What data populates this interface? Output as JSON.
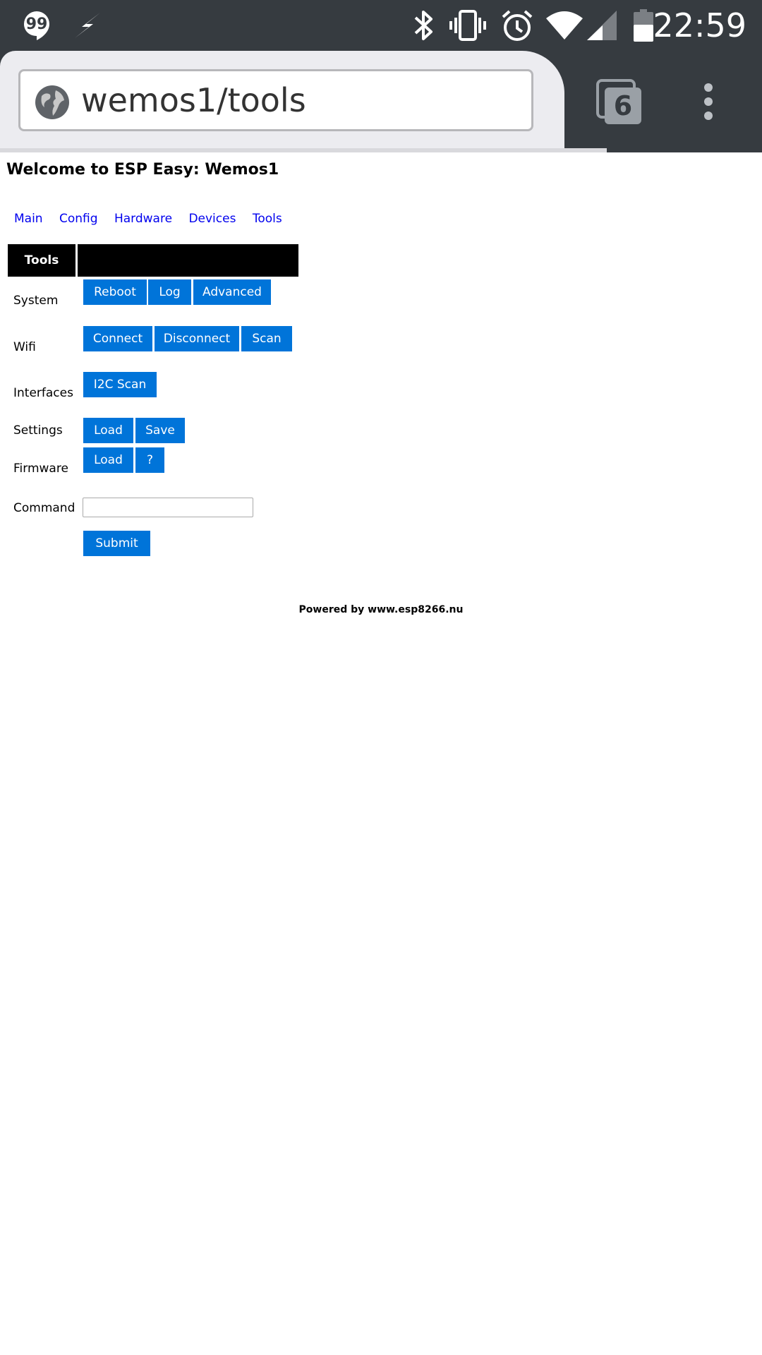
{
  "status_bar": {
    "time": "22:59",
    "icons": [
      "hangouts-icon",
      "lightning-icon",
      "bluetooth-icon",
      "vibrate-icon",
      "alarm-icon",
      "wifi-icon",
      "signal-icon",
      "battery-icon"
    ]
  },
  "browser": {
    "url": "wemos1/tools",
    "tab_count": "6"
  },
  "page": {
    "title": "Welcome to ESP Easy: Wemos1",
    "nav": [
      "Main",
      "Config",
      "Hardware",
      "Devices",
      "Tools"
    ],
    "table_header": "Tools",
    "rows": {
      "system": {
        "label": "System",
        "buttons": [
          "Reboot",
          "Log",
          "Advanced"
        ]
      },
      "wifi": {
        "label": "Wifi",
        "buttons": [
          "Connect",
          "Disconnect",
          "Scan"
        ]
      },
      "interfaces": {
        "label": "Interfaces",
        "buttons": [
          "I2C Scan"
        ]
      },
      "settings": {
        "label": "Settings",
        "buttons": [
          "Load",
          "Save"
        ]
      },
      "firmware": {
        "label": "Firmware",
        "buttons": [
          "Load",
          "?"
        ]
      },
      "command": {
        "label": "Command",
        "value": "",
        "submit": "Submit"
      }
    },
    "footer": "Powered by www.esp8266.nu"
  },
  "colors": {
    "button": "#0074d9",
    "link": "#0000ee",
    "status_bar": "#363b40"
  }
}
